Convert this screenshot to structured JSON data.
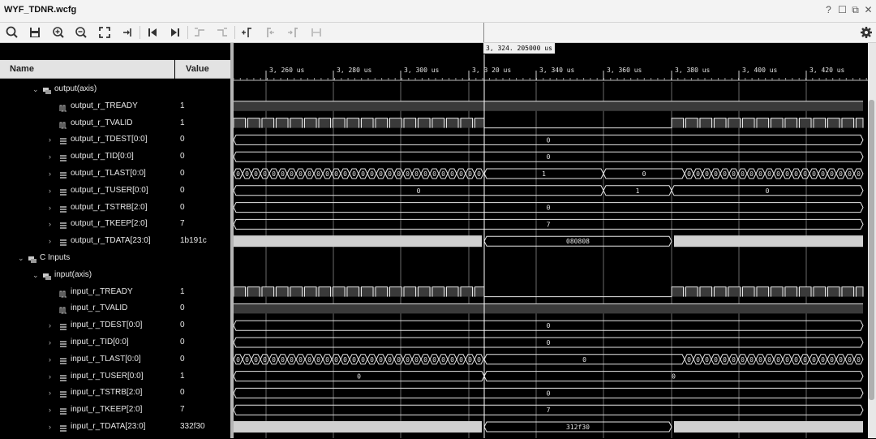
{
  "window": {
    "title": "WYF_TDNR.wcfg",
    "help": "?",
    "restore": "☐",
    "detach": "⧉",
    "close": "✕"
  },
  "toolbar": {
    "buttons": [
      "search-icon",
      "save-icon",
      "zoom-in-icon",
      "zoom-out-icon",
      "zoom-fit-icon",
      "go-to-cursor-icon",
      "go-to-start-icon",
      "go-to-end-icon",
      "previous-transition-icon",
      "next-transition-icon",
      "add-marker-icon",
      "previous-marker-icon",
      "next-marker-icon",
      "swap-cursors-icon"
    ],
    "settings": "gear-icon"
  },
  "cursor": {
    "label": "3, 324. 205000 us"
  },
  "columns": {
    "name": "Name",
    "value": "Value"
  },
  "time_axis": {
    "ticks": [
      "3, 260  us",
      "3, 280  us",
      "3, 300  us",
      "3, 3 20  us",
      "3, 340  us",
      "3, 360  us",
      "3, 380  us",
      "3, 400  us",
      "3, 420  us"
    ]
  },
  "signals": [
    {
      "name": "output(axis)",
      "value": "",
      "level": 2,
      "expand": "open",
      "icon": "group-icon"
    },
    {
      "name": "output_r_TREADY",
      "value": "1",
      "level": 3,
      "expand": "none",
      "icon": "bit-signal-icon",
      "wave": "bit-pattern-1"
    },
    {
      "name": "output_r_TVALID",
      "value": "1",
      "level": 3,
      "expand": "none",
      "icon": "bit-signal-icon",
      "wave": "bit-pattern-2"
    },
    {
      "name": "output_r_TDEST[0:0]",
      "value": "0",
      "level": 3,
      "expand": "closed",
      "icon": "bus-signal-icon",
      "wave": "bus",
      "bus_label": "0"
    },
    {
      "name": "output_r_TID[0:0]",
      "value": "0",
      "level": 3,
      "expand": "closed",
      "icon": "bus-signal-icon",
      "wave": "bus",
      "bus_label": "0"
    },
    {
      "name": "output_r_TLAST[0:0]",
      "value": "0",
      "level": 3,
      "expand": "closed",
      "icon": "bus-signal-icon",
      "wave": "bus-toggles",
      "bus_labels": [
        "1",
        "0"
      ]
    },
    {
      "name": "output_r_TUSER[0:0]",
      "value": "0",
      "level": 3,
      "expand": "closed",
      "icon": "bus-signal-icon",
      "wave": "bus-tuser-out",
      "bus_labels": [
        "0",
        "1",
        "0"
      ]
    },
    {
      "name": "output_r_TSTRB[2:0]",
      "value": "0",
      "level": 3,
      "expand": "closed",
      "icon": "bus-signal-icon",
      "wave": "bus",
      "bus_label": "0"
    },
    {
      "name": "output_r_TKEEP[2:0]",
      "value": "7",
      "level": 3,
      "expand": "closed",
      "icon": "bus-signal-icon",
      "wave": "bus",
      "bus_label": "7"
    },
    {
      "name": "output_r_TDATA[23:0]",
      "value": "1b191c",
      "level": 3,
      "expand": "closed",
      "icon": "bus-signal-icon",
      "wave": "bus-data",
      "bus_label": "080808"
    },
    {
      "name": "C Inputs",
      "value": "",
      "level": 1,
      "expand": "open",
      "icon": "group-icon"
    },
    {
      "name": "input(axis)",
      "value": "",
      "level": 2,
      "expand": "open",
      "icon": "group-icon"
    },
    {
      "name": "input_r_TREADY",
      "value": "1",
      "level": 3,
      "expand": "none",
      "icon": "bit-signal-icon",
      "wave": "bit-pattern-2"
    },
    {
      "name": "input_r_TVALID",
      "value": "0",
      "level": 3,
      "expand": "none",
      "icon": "bit-signal-icon",
      "wave": "bit-pattern-1"
    },
    {
      "name": "input_r_TDEST[0:0]",
      "value": "0",
      "level": 3,
      "expand": "closed",
      "icon": "bus-signal-icon",
      "wave": "bus",
      "bus_label": "0"
    },
    {
      "name": "input_r_TID[0:0]",
      "value": "0",
      "level": 3,
      "expand": "closed",
      "icon": "bus-signal-icon",
      "wave": "bus",
      "bus_label": "0"
    },
    {
      "name": "input_r_TLAST[0:0]",
      "value": "0",
      "level": 3,
      "expand": "closed",
      "icon": "bus-signal-icon",
      "wave": "bus-toggles-in",
      "bus_labels": [
        "0"
      ]
    },
    {
      "name": "input_r_TUSER[0:0]",
      "value": "1",
      "level": 3,
      "expand": "closed",
      "icon": "bus-signal-icon",
      "wave": "bus-tuser-in",
      "bus_labels": [
        "0",
        "0"
      ]
    },
    {
      "name": "input_r_TSTRB[2:0]",
      "value": "0",
      "level": 3,
      "expand": "closed",
      "icon": "bus-signal-icon",
      "wave": "bus",
      "bus_label": "0"
    },
    {
      "name": "input_r_TKEEP[2:0]",
      "value": "7",
      "level": 3,
      "expand": "closed",
      "icon": "bus-signal-icon",
      "wave": "bus",
      "bus_label": "7"
    },
    {
      "name": "input_r_TDATA[23:0]",
      "value": "332f30",
      "level": 3,
      "expand": "closed",
      "icon": "bus-signal-icon",
      "wave": "bus-data",
      "bus_label": "312f30"
    }
  ],
  "colors": {
    "wave": "#e6e6e6",
    "bus_fill": "#d0d0d0",
    "grid": "#6a6a6a",
    "cursor": "#ffffff",
    "low_fill": "#3a3a3a"
  }
}
